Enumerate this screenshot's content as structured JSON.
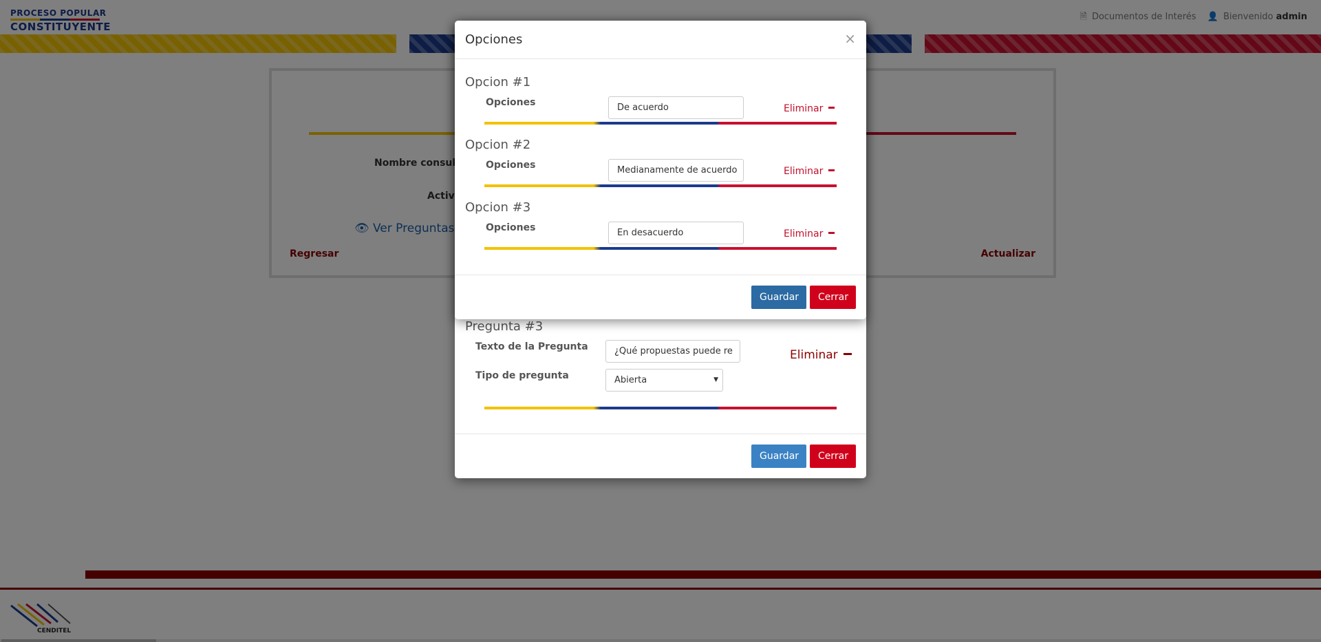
{
  "header": {
    "logo_line1": "PROCESO POPULAR",
    "logo_line2": "CONSTITUYENTE",
    "documents_link": "Documentos de Interés",
    "welcome": "Bienvenido",
    "user": "admin"
  },
  "main_form": {
    "nombre_label": "Nombre consulta",
    "activa_label": "Activa",
    "ver_preguntas": "Ver Preguntas",
    "regresar": "Regresar",
    "actualizar": "Actualizar"
  },
  "footer": {
    "logo_text": "CENDITEL"
  },
  "pregunta_modal": {
    "title": "Pregunta #3",
    "texto_label": "Texto de la Pregunta",
    "texto_value": "¿Qué propuestas puede re",
    "tipo_label": "Tipo de pregunta",
    "tipo_value": "Abierta",
    "eliminar": "Eliminar",
    "guardar": "Guardar",
    "cerrar": "Cerrar"
  },
  "opciones_modal": {
    "title": "Opciones",
    "close_symbol": "×",
    "options": [
      {
        "title": "Opcion #1",
        "label": "Opciones",
        "value": "De acuerdo",
        "eliminar": "Eliminar"
      },
      {
        "title": "Opcion #2",
        "label": "Opciones",
        "value": "Medianamente de acuerdo",
        "eliminar": "Eliminar"
      },
      {
        "title": "Opcion #3",
        "label": "Opciones",
        "value": "En desacuerdo",
        "eliminar": "Eliminar"
      }
    ],
    "guardar": "Guardar",
    "cerrar": "Cerrar"
  },
  "colors": {
    "yellow": "#f2c200",
    "blue": "#1a3a8c",
    "red": "#c8102e",
    "danger_text": "#c0102a",
    "primary_button": "#2b6aa3",
    "danger_button": "#d0021b"
  }
}
